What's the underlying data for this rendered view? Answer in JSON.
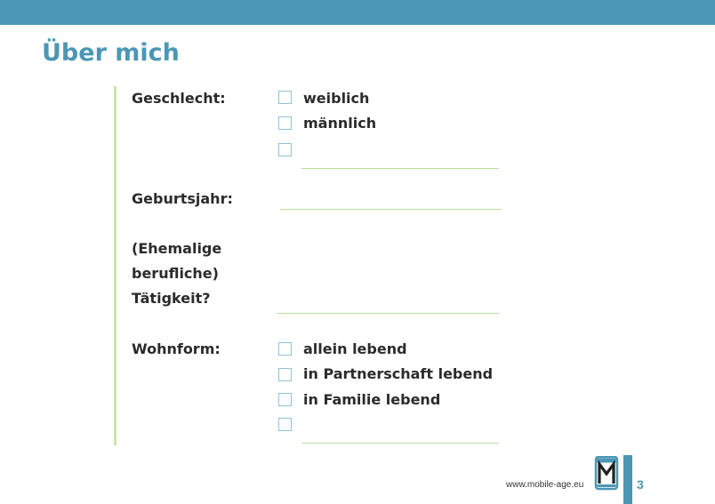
{
  "title": "Über mich",
  "colors": {
    "accent": "#4b97b5",
    "green_rule": "#c6e5a4",
    "checkbox_border": "#8fc3d8"
  },
  "gender": {
    "label": "Geschlecht:",
    "options": [
      "weiblich",
      "männlich"
    ]
  },
  "birth_year": {
    "label": "Geburtsjahr:"
  },
  "occupation": {
    "label_lines": [
      "(Ehemalige",
      "berufliche)",
      "Tätigkeit?"
    ]
  },
  "living": {
    "label": "Wohnform:",
    "options": [
      "allein lebend",
      "in Partnerschaft lebend",
      "in Familie lebend"
    ]
  },
  "footer": {
    "url": "www.mobile-age.eu",
    "page_number": "3",
    "logo_icon": "mobile-age-logo"
  }
}
